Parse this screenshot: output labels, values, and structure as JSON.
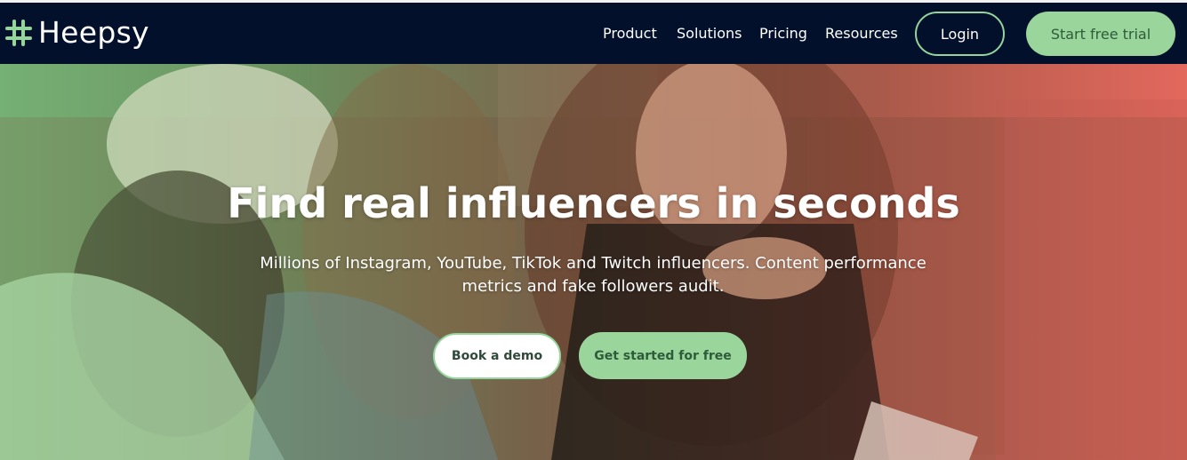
{
  "brand": {
    "name": "Heepsy",
    "logo_icon": "hash-grid-logo-icon",
    "accent": "#93d59b",
    "nav_bg": "#03102b"
  },
  "nav": {
    "links": [
      {
        "label": "Product"
      },
      {
        "label": "Solutions"
      },
      {
        "label": "Pricing"
      },
      {
        "label": "Resources"
      }
    ],
    "login_label": "Login",
    "trial_label": "Start free trial"
  },
  "hero": {
    "title": "Find real influencers in seconds",
    "subtitle": "Millions of Instagram, YouTube, TikTok and Twitch influencers. Content performance metrics and fake followers audit.",
    "demo_label": "Book a demo",
    "start_label": "Get started for free"
  }
}
